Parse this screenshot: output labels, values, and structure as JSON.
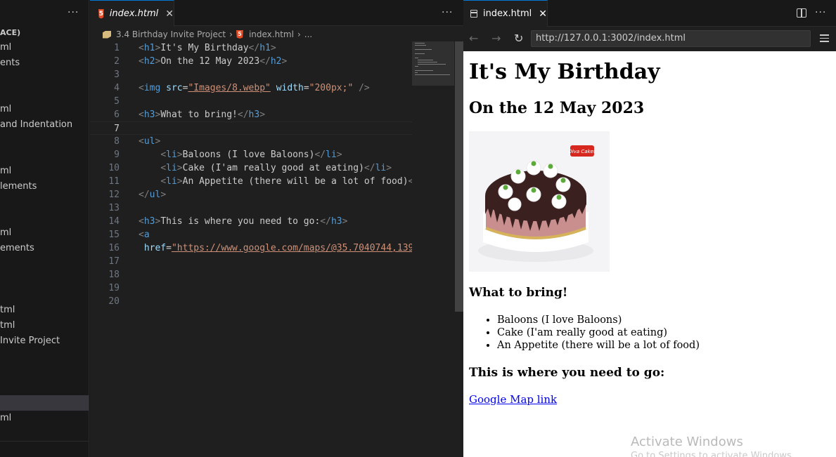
{
  "sidebar": {
    "section_title": "ACE)",
    "items": [
      {
        "label": "ml"
      },
      {
        "label": "ents"
      },
      {
        "label": "ml"
      },
      {
        "label": "and Indentation"
      },
      {
        "label": "ml"
      },
      {
        "label": "lements"
      },
      {
        "label": "ml"
      },
      {
        "label": "ements"
      },
      {
        "label": "tml"
      },
      {
        "label": "tml"
      },
      {
        "label": "Invite Project"
      },
      {
        "label": "ml"
      }
    ]
  },
  "editor": {
    "tab_label": "index.html",
    "tab_icon": "html5-icon",
    "breadcrumb": {
      "folder": "3.4 Birthday Invite Project",
      "file": "index.html",
      "ellipsis": "..."
    },
    "current_line": 7,
    "lines": [
      {
        "n": "1"
      },
      {
        "n": "2"
      },
      {
        "n": "3"
      },
      {
        "n": "4"
      },
      {
        "n": "5"
      },
      {
        "n": "6"
      },
      {
        "n": "7"
      },
      {
        "n": "8"
      },
      {
        "n": "9"
      },
      {
        "n": "10"
      },
      {
        "n": "11"
      },
      {
        "n": "12"
      },
      {
        "n": "13"
      },
      {
        "n": "14"
      },
      {
        "n": "15"
      },
      {
        "n": "16"
      },
      {
        "n": "17"
      },
      {
        "n": "18"
      },
      {
        "n": "19"
      },
      {
        "n": "20"
      }
    ],
    "code": {
      "h1_text": "It's My Birthday",
      "h2_text": "On the 12 May 2023",
      "img_src": "\"Images/8.webp\"",
      "img_width": "\"200px;\"",
      "h3_bring": "What to bring!",
      "li1": "Baloons (I love Baloons)",
      "li2": "Cake (I'am really good at eating)",
      "li3": "An Appetite (there will be a lot of food)",
      "h3_go": "This is where you need to go:",
      "href_value": "\"https://www.google.com/maps/@35.7040744,139."
    }
  },
  "preview": {
    "tab_label": "index.html",
    "url": "http://127.0.0.1:3002/index.html",
    "page": {
      "h1": "It's My Birthday",
      "h2": "On the 12 May 2023",
      "h3_bring": "What to bring!",
      "list": [
        "Baloons (I love Baloons)",
        "Cake (I'am really good at eating)",
        "An Appetite (there will be a lot of food)"
      ],
      "h3_go": "This is where you need to go:",
      "link": "Google Map link",
      "cake_logo": "Diva Cakes"
    },
    "watermark": {
      "title": "Activate Windows",
      "subtitle": "Go to Settings to activate Windows."
    }
  },
  "colors": {
    "accent": "#0078d4",
    "tag": "#569cd6",
    "attribute": "#9cdcfe",
    "string": "#ce9178",
    "link": "#0000ee"
  }
}
